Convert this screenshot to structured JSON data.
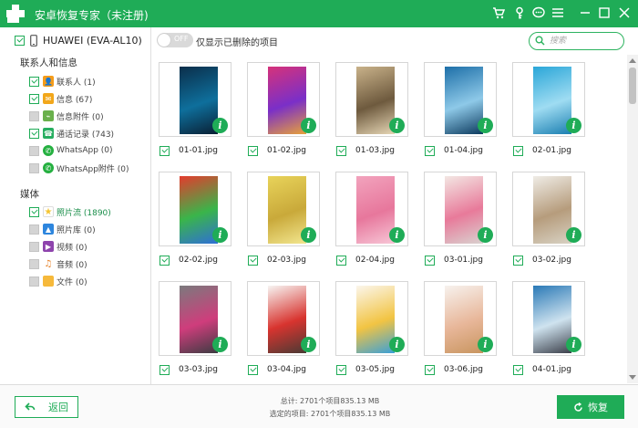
{
  "titlebar": {
    "title": "安卓恢复专家（未注册)",
    "bg_color": "#1fac57",
    "icons": [
      "cart-icon",
      "key-icon",
      "chat-icon",
      "menu-icon",
      "minimize-icon",
      "maximize-icon",
      "close-icon"
    ]
  },
  "sidebar": {
    "device_name": "HUAWEI (EVA-AL10)",
    "sections": [
      {
        "title": "联系人和信息",
        "items": [
          {
            "label": "联系人 (1)",
            "checked": true,
            "icon": "contacts-icon",
            "icon_color": "#f59c1a"
          },
          {
            "label": "信息 (67)",
            "checked": true,
            "icon": "message-icon",
            "icon_color": "#f2a71b"
          },
          {
            "label": "信息附件 (0)",
            "checked": false,
            "icon": "attachment-icon",
            "icon_color": "#6ab04c"
          },
          {
            "label": "通话记录 (743)",
            "checked": true,
            "icon": "call-log-icon",
            "icon_color": "#27ae60"
          },
          {
            "label": "WhatsApp (0)",
            "checked": false,
            "icon": "whatsapp-icon",
            "icon_color": "#25b040"
          },
          {
            "label": "WhatsApp附件 (0)",
            "checked": false,
            "icon": "whatsapp-attachment-icon",
            "icon_color": "#25b040"
          }
        ]
      },
      {
        "title": "媒体",
        "items": [
          {
            "label": "照片流 (1890)",
            "checked": true,
            "icon": "photo-stream-icon",
            "icon_color": "#f4c430",
            "active": true
          },
          {
            "label": "照片库 (0)",
            "checked": false,
            "icon": "photo-library-icon",
            "icon_color": "#2e86de"
          },
          {
            "label": "视频 (0)",
            "checked": false,
            "icon": "video-icon",
            "icon_color": "#8e44ad"
          },
          {
            "label": "音频 (0)",
            "checked": false,
            "icon": "audio-icon",
            "icon_color": "#e67e22"
          },
          {
            "label": "文件 (0)",
            "checked": false,
            "icon": "folder-icon",
            "icon_color": "#f6b93b"
          }
        ]
      }
    ]
  },
  "toolbar": {
    "toggle_text": "OFF",
    "toggle_label": "仅显示已删除的项目",
    "search_placeholder": "搜索"
  },
  "gallery": {
    "items": [
      {
        "name": "01-01.jpg",
        "colors": [
          "#0b2e4a",
          "#0e6f9c",
          "#0a1f33"
        ]
      },
      {
        "name": "01-02.jpg",
        "colors": [
          "#d6327a",
          "#7a2fc8",
          "#e8a13a"
        ]
      },
      {
        "name": "01-03.jpg",
        "colors": [
          "#c9b28a",
          "#6e5a3e",
          "#e6d6b5"
        ]
      },
      {
        "name": "01-04.jpg",
        "colors": [
          "#1d6fa8",
          "#8ec9e8",
          "#0c3a5e"
        ]
      },
      {
        "name": "02-01.jpg",
        "colors": [
          "#2aa6d8",
          "#9fdcf2",
          "#1b7fb1"
        ]
      },
      {
        "name": "02-02.jpg",
        "colors": [
          "#e43b2d",
          "#3ab54a",
          "#2f6fd6"
        ]
      },
      {
        "name": "02-03.jpg",
        "colors": [
          "#e8d35a",
          "#c9a93a",
          "#f2e68f"
        ]
      },
      {
        "name": "02-04.jpg",
        "colors": [
          "#f2a3bd",
          "#e7779c",
          "#f7c6d6"
        ]
      },
      {
        "name": "03-01.jpg",
        "colors": [
          "#f3e7e3",
          "#e87a9a",
          "#d9d2cf"
        ]
      },
      {
        "name": "03-02.jpg",
        "colors": [
          "#efece6",
          "#b69c7c",
          "#d8d2c4"
        ]
      },
      {
        "name": "03-03.jpg",
        "colors": [
          "#7b7a7d",
          "#cf3d7c",
          "#3d3c42"
        ]
      },
      {
        "name": "03-04.jpg",
        "colors": [
          "#f7f5f3",
          "#d8342f",
          "#4a3a34"
        ]
      },
      {
        "name": "03-05.jpg",
        "colors": [
          "#fbf6ec",
          "#f2c443",
          "#3aa0d8"
        ]
      },
      {
        "name": "03-06.jpg",
        "colors": [
          "#f7f2ee",
          "#e8b79a",
          "#c8955f"
        ]
      },
      {
        "name": "04-01.jpg",
        "colors": [
          "#2a79b6",
          "#cfe3ef",
          "#3b3f4a"
        ]
      }
    ]
  },
  "footer": {
    "back_label": "返回",
    "total_line": "总计: 2701个项目835.13 MB",
    "selected_line": "选定的项目: 2701个项目835.13 MB",
    "restore_label": "恢复"
  }
}
